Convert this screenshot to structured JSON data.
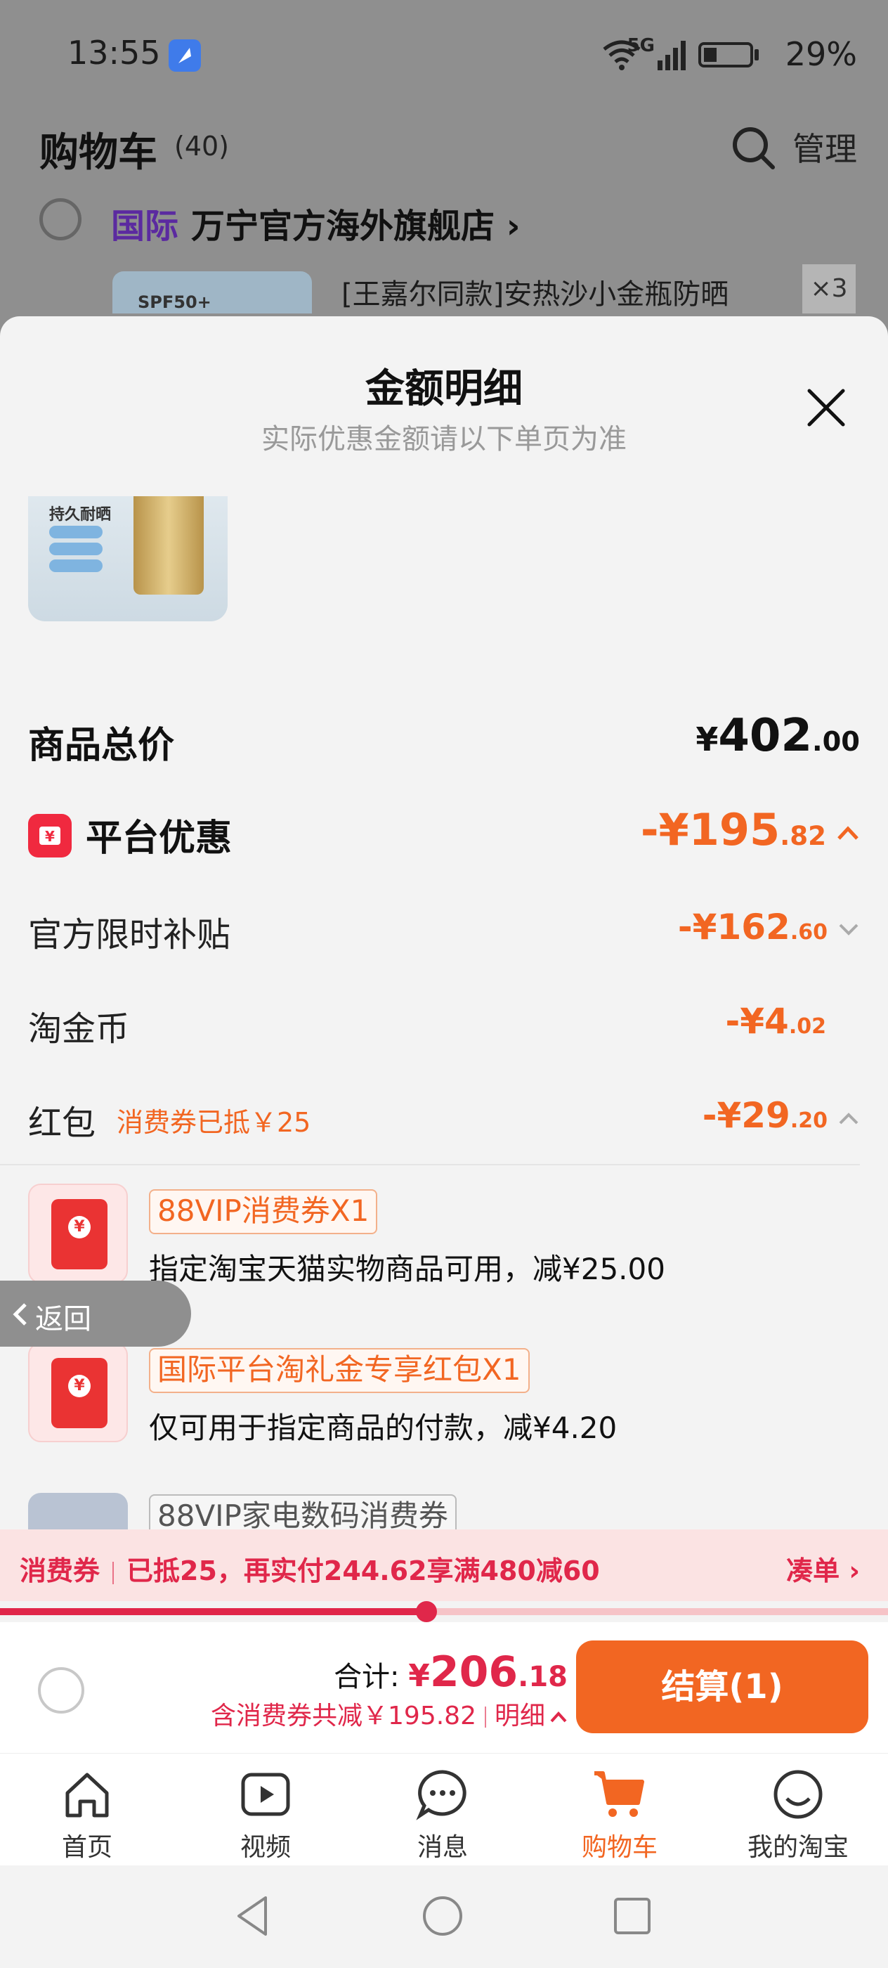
{
  "status_bar": {
    "time": "13:55",
    "network": "5G",
    "battery": "29%"
  },
  "header": {
    "title": "购物车",
    "count": "(40)",
    "manage": "管理"
  },
  "store": {
    "tag": "国际",
    "name": "万宁官方海外旗舰店",
    "chevron": "›"
  },
  "product": {
    "title": "[王嘉尔同款]安热沙小金瓶防晒",
    "qty": "×3",
    "thumb_text": "SPF50+"
  },
  "sheet": {
    "title": "金额明细",
    "subtitle": "实际优惠金额请以下单页为准",
    "thumb_text": "持久耐晒",
    "total": {
      "label": "商品总价",
      "symbol": "¥",
      "int": "402",
      "dec": ".00"
    },
    "platform": {
      "label": "平台优惠",
      "prefix": "-¥",
      "int": "195",
      "dec": ".82"
    },
    "subsidy": {
      "label": "官方限时补贴",
      "prefix": "-¥",
      "int": "162",
      "dec": ".60"
    },
    "coins": {
      "label": "淘金币",
      "prefix": "-¥",
      "int": "4",
      "dec": ".02"
    },
    "redpacket": {
      "label": "红包",
      "note": "消费券已抵￥25",
      "prefix": "-¥",
      "int": "29",
      "dec": ".20"
    },
    "coupons": [
      {
        "tag": "88VIP消费券X1",
        "desc": "指定淘宝天猫实物商品可用，减¥25.00"
      },
      {
        "tag": "国际平台淘礼金专享红包X1",
        "desc": "仅可用于指定商品的付款，减¥4.20"
      },
      {
        "tag": "88VIP家电数码消费券",
        "desc": ""
      }
    ]
  },
  "back_button": "返回",
  "promo": {
    "label": "消费券",
    "text": "已抵25，再实付244.62享满480减60",
    "link": "凑单 ›",
    "progress": 0.48
  },
  "bottom": {
    "sum_label": "合计:",
    "sum_symbol": "¥",
    "sum_int": "206",
    "sum_dec": ".18",
    "sub_text": "含消费券共减￥195.82",
    "detail_link": "明细",
    "checkout": "结算(1)"
  },
  "tabs": [
    {
      "label": "首页",
      "icon": "home-icon"
    },
    {
      "label": "视频",
      "icon": "video-icon"
    },
    {
      "label": "消息",
      "icon": "message-icon"
    },
    {
      "label": "购物车",
      "icon": "cart-icon"
    },
    {
      "label": "我的淘宝",
      "icon": "profile-icon"
    }
  ],
  "colors": {
    "accent": "#f26622",
    "promo_red": "#e0274a",
    "platform_icon": "#f0293f"
  }
}
